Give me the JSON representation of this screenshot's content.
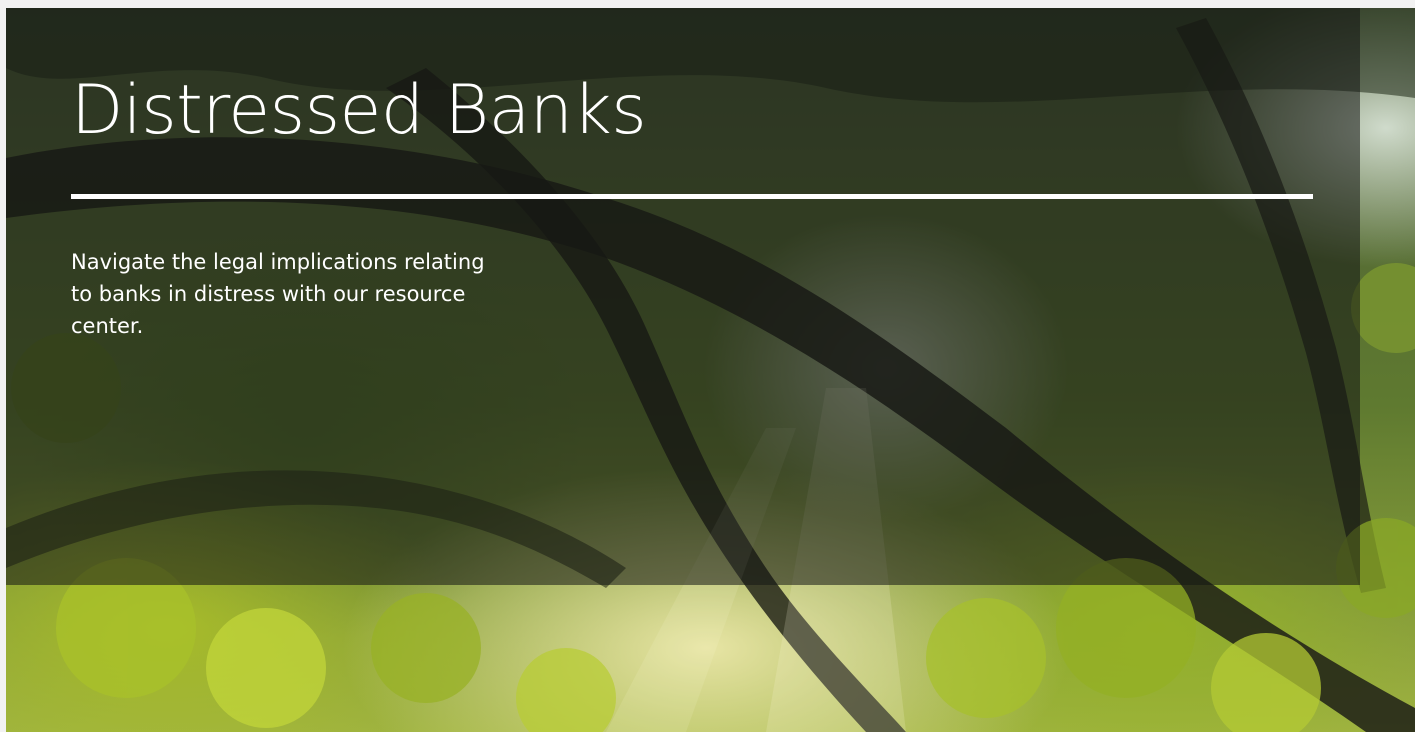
{
  "hero": {
    "title": "Distressed Banks",
    "description": "Navigate the legal implications relating to banks in distress with our resource center."
  }
}
